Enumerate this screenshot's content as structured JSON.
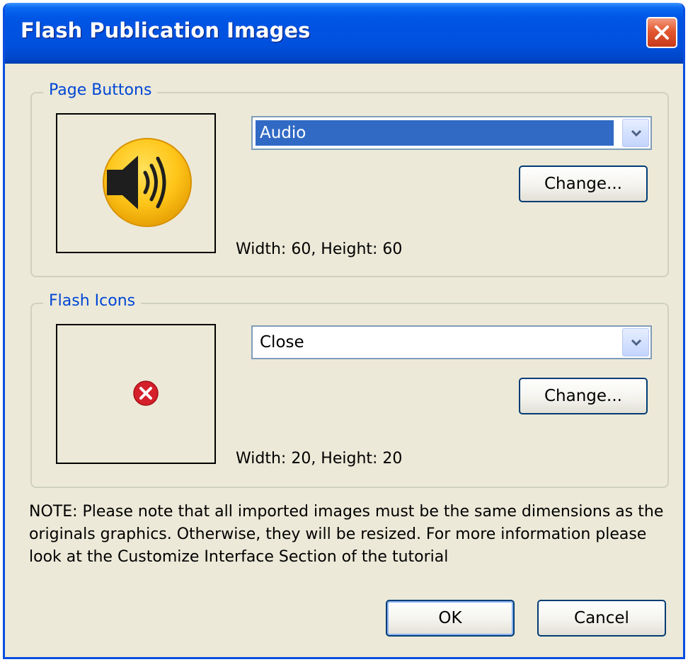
{
  "window": {
    "title": "Flash Publication Images"
  },
  "page_buttons": {
    "group_title": "Page Buttons",
    "selected": "Audio",
    "change_label": "Change...",
    "dimensions": "Width: 60, Height: 60",
    "preview_icon": "speaker-icon"
  },
  "flash_icons": {
    "group_title": "Flash Icons",
    "selected": "Close",
    "change_label": "Change...",
    "dimensions": "Width: 20, Height: 20",
    "preview_icon": "red-x-circle-icon"
  },
  "note": "NOTE: Please note that all imported images must be the same dimensions as the originals graphics. Otherwise, they will be resized. For more information please look at the Customize Interface Section of the tutorial",
  "buttons": {
    "ok": "OK",
    "cancel": "Cancel"
  },
  "colors": {
    "titlebar": "#0055e5",
    "dialog_bg": "#ece9d8",
    "selection": "#316ac5",
    "group_title": "#0046d5",
    "close_button": "#e2582f"
  }
}
